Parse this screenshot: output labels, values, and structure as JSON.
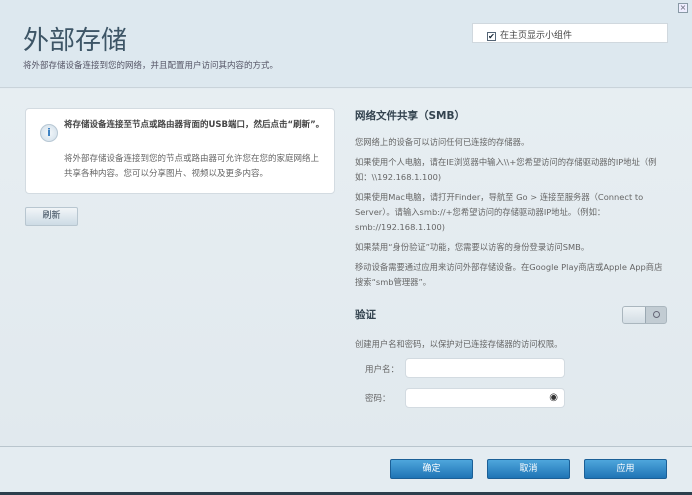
{
  "header": {
    "title": "外部存储",
    "subtitle": "将外部存储设备连接到您的网络，并且配置用户访问其内容的方式。",
    "show_widget_label": "在主页显示小组件",
    "show_widget_checked": true,
    "close_icon": "close-icon"
  },
  "info": {
    "bold": "将存储设备连接至节点或路由器背面的USB端口，然后点击“刷新”。",
    "text": "将外部存储设备连接到您的节点或路由器可允许您在您的家庭网络上共享各种内容。您可以分享图片、视频以及更多内容。",
    "icon": "info-icon"
  },
  "refresh_label": "刷新",
  "smb": {
    "title": "网络文件共享（SMB）",
    "paragraphs": [
      "您网络上的设备可以访问任何已连接的存储器。",
      "如果使用个人电脑，请在IE浏览器中输入\\\\+您希望访问的存储驱动器的IP地址（例如：\\\\192.168.1.100)",
      "如果使用Mac电脑，请打开Finder，导航至 Go > 连接至服务器（Connect to Server）。请输入smb://+您希望访问的存储驱动器IP地址。（例如：smb://192.168.1.100)",
      "如果禁用“身份验证”功能，您需要以访客的身份登录访问SMB。",
      "移动设备需要通过应用来访问外部存储设备。在Google Play商店或Apple App商店搜索“smb管理器”。"
    ]
  },
  "auth": {
    "title": "验证",
    "enabled": false,
    "description": "创建用户名和密码，以保护对已连接存储器的访问权限。",
    "username_label": "用户名：",
    "username_value": "",
    "password_label": "密码：",
    "password_value": ""
  },
  "footer": {
    "ok": "确定",
    "cancel": "取消",
    "apply": "应用"
  }
}
